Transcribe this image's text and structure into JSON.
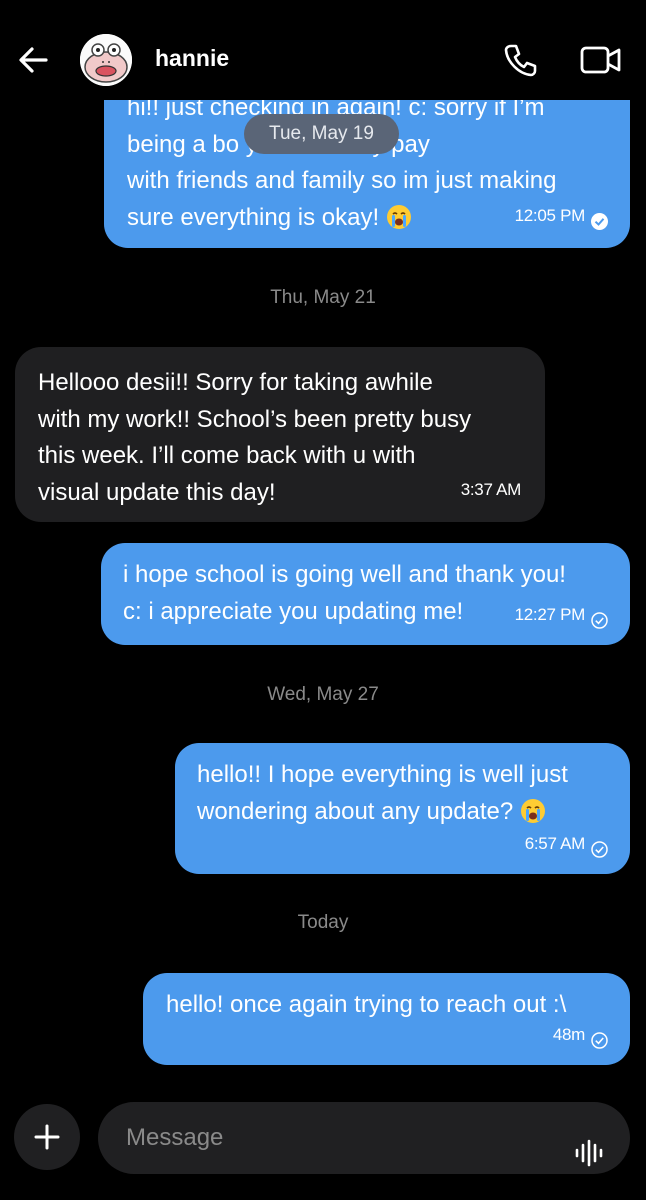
{
  "header": {
    "contact_name": "hannie",
    "icons": {
      "back": "back-arrow-icon",
      "call": "phone-icon",
      "video": "video-camera-icon"
    }
  },
  "sticky_date": "Tue, May 19",
  "messages": [
    {
      "direction": "outgoing",
      "text": "hi!! just checking in again! c: sorry if I’m\nbeing a bo        y  t     n’t usually pay\nwith friends and family so im just making\nsure everything is okay!",
      "emoji": "crying-face",
      "time": "12:05 PM",
      "status": "read"
    },
    {
      "direction": "incoming",
      "text": "Hellooo desii!! Sorry for taking awhile\nwith my work!! School’s been pretty busy\nthis week. I’ll come back with u with\nvisual update this day!",
      "time": "3:37 AM"
    },
    {
      "direction": "outgoing",
      "text": "i hope school is going well and thank you!\nc: i appreciate you updating me!",
      "time": "12:27 PM",
      "status": "sent"
    },
    {
      "direction": "outgoing",
      "text": "hello!! I hope everything is well just\nwondering about any update?",
      "emoji": "crying-face",
      "time": "6:57 AM",
      "status": "sent"
    },
    {
      "direction": "outgoing",
      "text": "hello! once again trying to reach out :\\",
      "time": "48m",
      "status": "sent"
    }
  ],
  "date_separators": [
    "Thu, May 21",
    "Wed, May 27",
    "Today"
  ],
  "composer": {
    "placeholder": "Message",
    "icons": {
      "add": "plus-icon",
      "voice": "voice-wave-icon"
    }
  },
  "colors": {
    "outgoing_bubble": "#4c9aed",
    "incoming_bubble": "#1f1f21",
    "background": "#000000"
  }
}
